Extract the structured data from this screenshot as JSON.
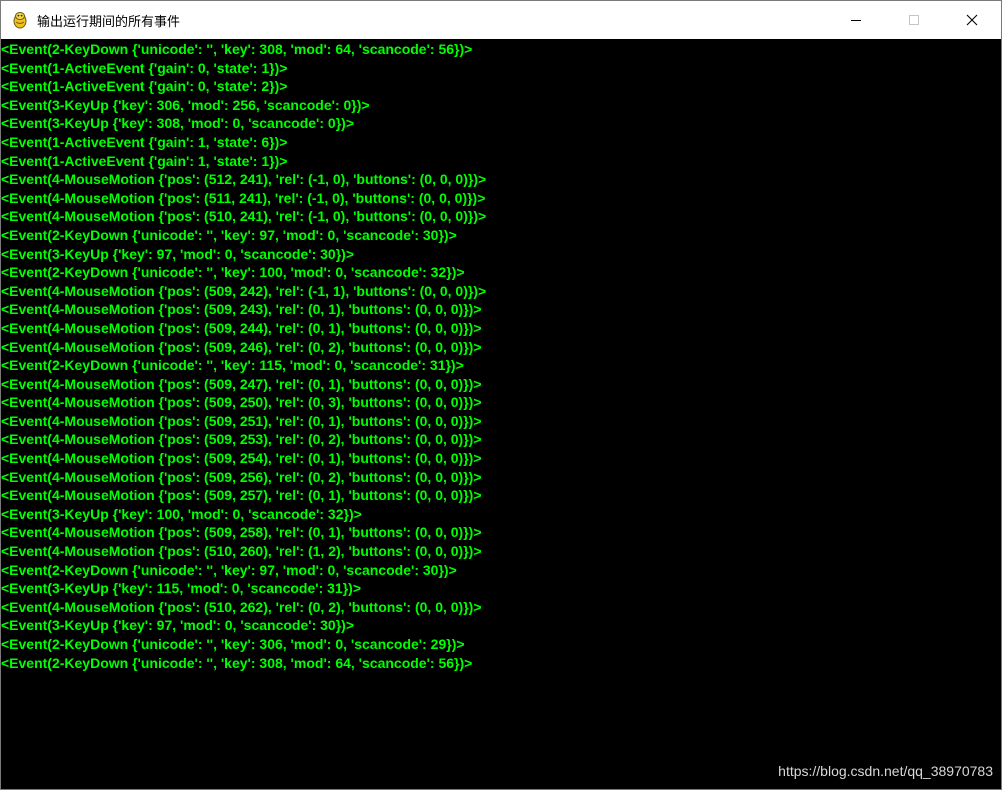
{
  "window": {
    "title": "输出运行期间的所有事件",
    "icon": "pygame-snake-icon",
    "controls": [
      "minimize-icon",
      "maximize-icon",
      "close-icon"
    ]
  },
  "colors": {
    "console_background": "#000000",
    "log_text": "#00ff00",
    "titlebar": "#ffffff"
  },
  "log_lines": [
    "<Event(2-KeyDown {'unicode': '', 'key': 308, 'mod': 64, 'scancode': 56})>",
    "<Event(1-ActiveEvent {'gain': 0, 'state': 1})>",
    "<Event(1-ActiveEvent {'gain': 0, 'state': 2})>",
    "<Event(3-KeyUp {'key': 306, 'mod': 256, 'scancode': 0})>",
    "<Event(3-KeyUp {'key': 308, 'mod': 0, 'scancode': 0})>",
    "<Event(1-ActiveEvent {'gain': 1, 'state': 6})>",
    "<Event(1-ActiveEvent {'gain': 1, 'state': 1})>",
    "<Event(4-MouseMotion {'pos': (512, 241), 'rel': (-1, 0), 'buttons': (0, 0, 0)})>",
    "<Event(4-MouseMotion {'pos': (511, 241), 'rel': (-1, 0), 'buttons': (0, 0, 0)})>",
    "<Event(4-MouseMotion {'pos': (510, 241), 'rel': (-1, 0), 'buttons': (0, 0, 0)})>",
    "<Event(2-KeyDown {'unicode': '', 'key': 97, 'mod': 0, 'scancode': 30})>",
    "<Event(3-KeyUp {'key': 97, 'mod': 0, 'scancode': 30})>",
    "<Event(2-KeyDown {'unicode': '', 'key': 100, 'mod': 0, 'scancode': 32})>",
    "<Event(4-MouseMotion {'pos': (509, 242), 'rel': (-1, 1), 'buttons': (0, 0, 0)})>",
    "<Event(4-MouseMotion {'pos': (509, 243), 'rel': (0, 1), 'buttons': (0, 0, 0)})>",
    "<Event(4-MouseMotion {'pos': (509, 244), 'rel': (0, 1), 'buttons': (0, 0, 0)})>",
    "<Event(4-MouseMotion {'pos': (509, 246), 'rel': (0, 2), 'buttons': (0, 0, 0)})>",
    "<Event(2-KeyDown {'unicode': '', 'key': 115, 'mod': 0, 'scancode': 31})>",
    "<Event(4-MouseMotion {'pos': (509, 247), 'rel': (0, 1), 'buttons': (0, 0, 0)})>",
    "<Event(4-MouseMotion {'pos': (509, 250), 'rel': (0, 3), 'buttons': (0, 0, 0)})>",
    "<Event(4-MouseMotion {'pos': (509, 251), 'rel': (0, 1), 'buttons': (0, 0, 0)})>",
    "<Event(4-MouseMotion {'pos': (509, 253), 'rel': (0, 2), 'buttons': (0, 0, 0)})>",
    "<Event(4-MouseMotion {'pos': (509, 254), 'rel': (0, 1), 'buttons': (0, 0, 0)})>",
    "<Event(4-MouseMotion {'pos': (509, 256), 'rel': (0, 2), 'buttons': (0, 0, 0)})>",
    "<Event(4-MouseMotion {'pos': (509, 257), 'rel': (0, 1), 'buttons': (0, 0, 0)})>",
    "<Event(3-KeyUp {'key': 100, 'mod': 0, 'scancode': 32})>",
    "<Event(4-MouseMotion {'pos': (509, 258), 'rel': (0, 1), 'buttons': (0, 0, 0)})>",
    "<Event(4-MouseMotion {'pos': (510, 260), 'rel': (1, 2), 'buttons': (0, 0, 0)})>",
    "<Event(2-KeyDown {'unicode': '', 'key': 97, 'mod': 0, 'scancode': 30})>",
    "<Event(3-KeyUp {'key': 115, 'mod': 0, 'scancode': 31})>",
    "<Event(4-MouseMotion {'pos': (510, 262), 'rel': (0, 2), 'buttons': (0, 0, 0)})>",
    "<Event(3-KeyUp {'key': 97, 'mod': 0, 'scancode': 30})>",
    "<Event(2-KeyDown {'unicode': '', 'key': 306, 'mod': 0, 'scancode': 29})>",
    "<Event(2-KeyDown {'unicode': '', 'key': 308, 'mod': 64, 'scancode': 56})>"
  ],
  "watermark": "https://blog.csdn.net/qq_38970783"
}
